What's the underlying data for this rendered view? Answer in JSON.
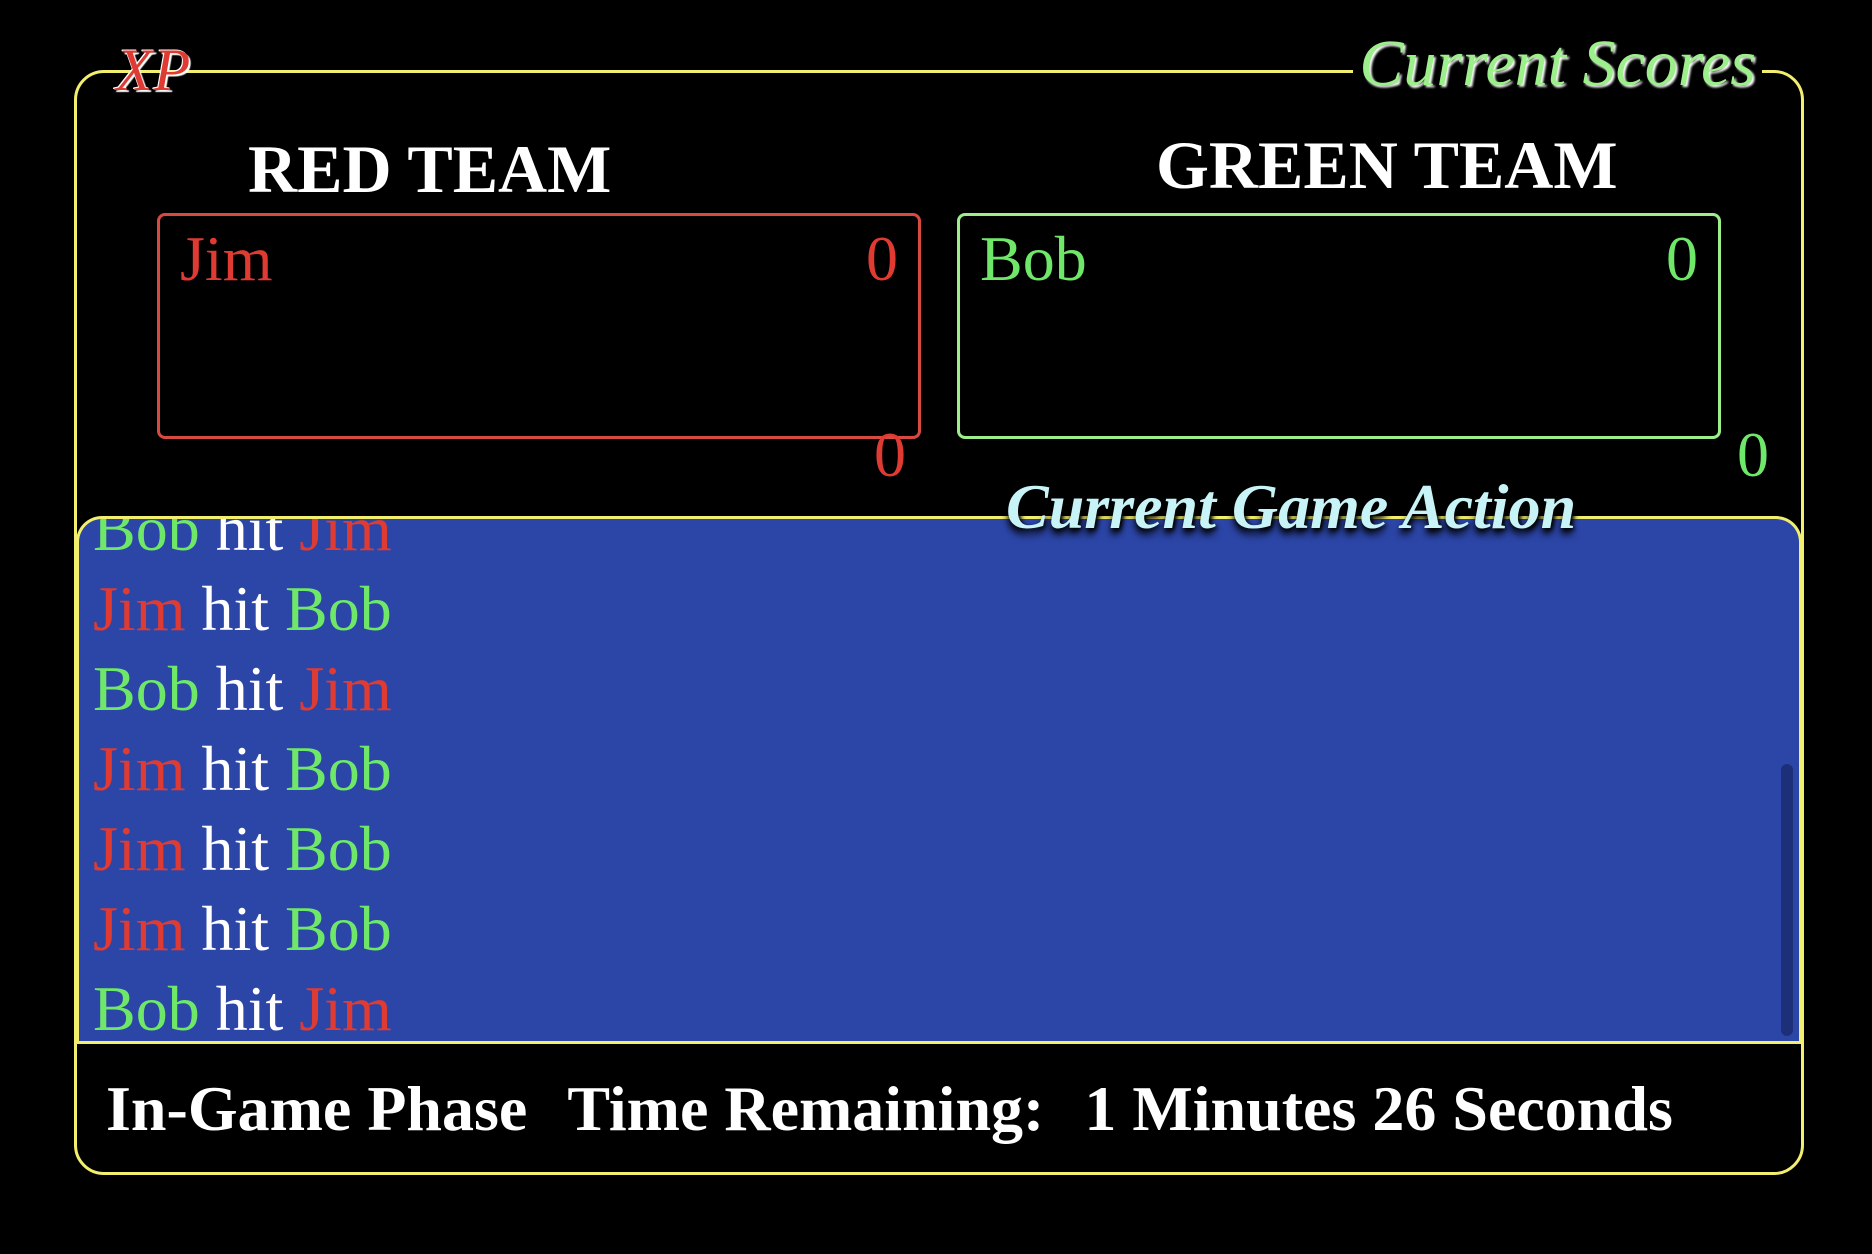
{
  "logo": "XP",
  "scores_title": "Current Scores",
  "red_team": {
    "title": "RED TEAM",
    "players": [
      {
        "name": "Jim",
        "score": "0"
      }
    ],
    "total": "0"
  },
  "green_team": {
    "title": "GREEN TEAM",
    "players": [
      {
        "name": "Bob",
        "score": "0"
      }
    ],
    "total": "0"
  },
  "action_title": "Current Game Action",
  "hit_word": "hit",
  "log": [
    {
      "attacker": "Bob",
      "attacker_team": "green",
      "target": "Jim",
      "target_team": "red"
    },
    {
      "attacker": "Jim",
      "attacker_team": "red",
      "target": "Bob",
      "target_team": "green"
    },
    {
      "attacker": "Bob",
      "attacker_team": "green",
      "target": "Jim",
      "target_team": "red"
    },
    {
      "attacker": "Jim",
      "attacker_team": "red",
      "target": "Bob",
      "target_team": "green"
    },
    {
      "attacker": "Jim",
      "attacker_team": "red",
      "target": "Bob",
      "target_team": "green"
    },
    {
      "attacker": "Jim",
      "attacker_team": "red",
      "target": "Bob",
      "target_team": "green"
    },
    {
      "attacker": "Bob",
      "attacker_team": "green",
      "target": "Jim",
      "target_team": "red"
    }
  ],
  "status": {
    "phase": "In-Game Phase",
    "time_label": "Time Remaining:",
    "time_value": "1 Minutes 26 Seconds"
  },
  "colors": {
    "red": "#e03b33",
    "green": "#6fe86a",
    "frame": "#f3ef6e",
    "log_bg": "#2c46a8"
  }
}
